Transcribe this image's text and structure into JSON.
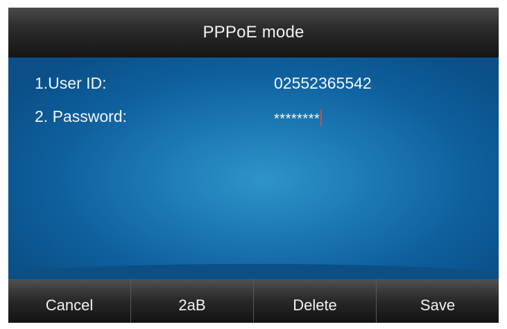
{
  "title": "PPPoE mode",
  "fields": [
    {
      "label": "1.User ID:",
      "value": "02552365542"
    },
    {
      "label": "2. Password:",
      "value": "********"
    }
  ],
  "softkeys": [
    "Cancel",
    "2aB",
    "Delete",
    "Save"
  ],
  "colors": {
    "screen_background": "#1b77b3",
    "bar_background": "#2c2c2c",
    "text": "#f4f7fb",
    "cursor": "#e0483a"
  }
}
